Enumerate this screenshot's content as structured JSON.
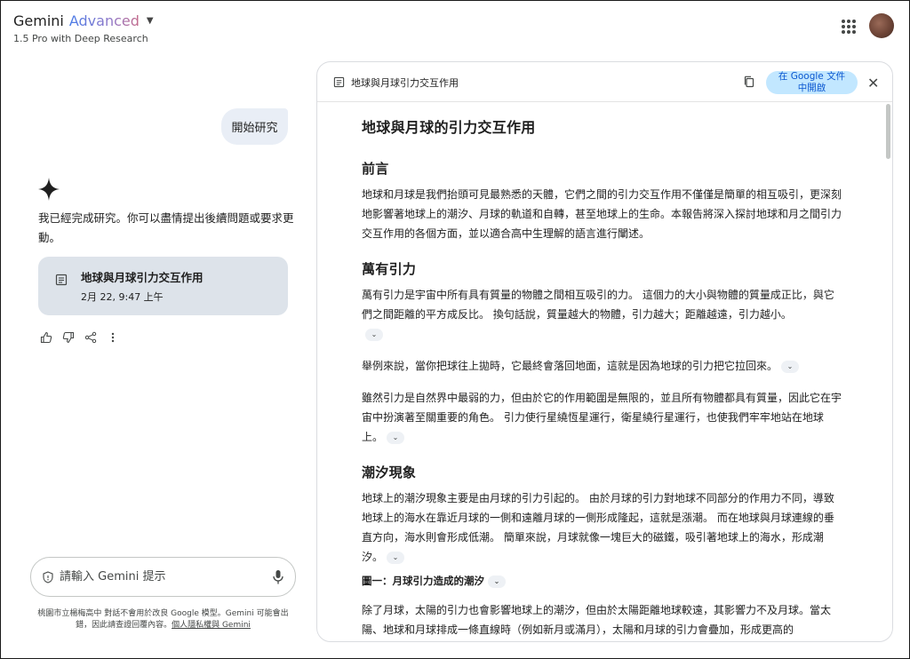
{
  "header": {
    "brand": "Gemini",
    "brand_tier": "Advanced",
    "model": "1.5 Pro with Deep Research"
  },
  "chat": {
    "user_message": "開始研究",
    "reply": "我已經完成研究。你可以盡情提出後續問題或要求更動。",
    "doc_card": {
      "title": "地球與月球引力交互作用",
      "time": "2月 22, 9:47 上午"
    }
  },
  "input": {
    "placeholder": "請輸入 Gemini 提示"
  },
  "disclaimer": {
    "text": "桃園市立楊梅高中 對話不會用於改良 Google 模型。Gemini 可能會出錯，因此請查證回覆內容。",
    "link": "個人隱私權與 Gemini"
  },
  "panel": {
    "title": "地球與月球引力交互作用",
    "open_docs_line1": "在 Google 文件",
    "open_docs_line2": "中開啟",
    "doc_title": "地球與月球的引力交互作用",
    "sections": {
      "intro_heading": "前言",
      "intro_p": "地球和月球是我們抬頭可見最熟悉的天體，它們之間的引力交互作用不僅僅是簡單的相互吸引，更深刻地影響著地球上的潮汐、月球的軌道和自轉，甚至地球上的生命。本報告將深入探討地球和月之間引力交互作用的各個方面，並以適合高中生理解的語言進行闡述。",
      "gravity_heading": "萬有引力",
      "gravity_p1": "萬有引力是宇宙中所有具有質量的物體之間相互吸引的力。 這個力的大小與物體的質量成正比，與它們之間距離的平方成反比。 換句話說，質量越大的物體，引力越大；距離越遠，引力越小。",
      "gravity_p2": "舉例來說，當你把球往上拋時，它最終會落回地面，這就是因為地球的引力把它拉回來。",
      "gravity_p3": "雖然引力是自然界中最弱的力，但由於它的作用範圍是無限的，並且所有物體都具有質量，因此它在宇宙中扮演著至關重要的角色。 引力使行星繞恆星運行，衛星繞行星運行，也使我們牢牢地站在地球上。",
      "tide_heading": "潮汐現象",
      "tide_p1": "地球上的潮汐現象主要是由月球的引力引起的。 由於月球的引力對地球不同部分的作用力不同，導致地球上的海水在靠近月球的一側和遠離月球的一側形成隆起，這就是漲潮。 而在地球與月球連線的垂直方向，海水則會形成低潮。 簡單來說，月球就像一塊巨大的磁鐵，吸引著地球上的海水，形成潮汐。",
      "figure_label": "圖一：月球引力造成的潮汐",
      "tide_p2": "除了月球，太陽的引力也會影響地球上的潮汐，但由於太陽距離地球較遠，其影響力不及月球。當太陽、地球和月球排成一條直線時（例如新月或滿月），太陽和月球的引力會疊加，形成更高的"
    }
  }
}
